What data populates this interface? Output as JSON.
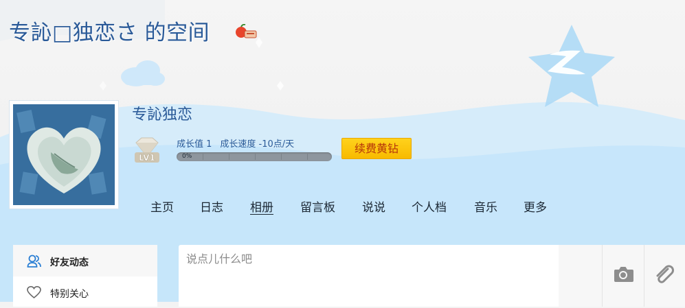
{
  "header": {
    "space_title": "专訫□独恋さ 的空间",
    "title_icon": "apple-vip-icon"
  },
  "profile": {
    "nickname": "专訫独恋",
    "level_badge": "LV1",
    "growth_value": "成长值 1",
    "growth_speed": "成长速度 -10点/天",
    "progress_label": "0%",
    "progress": 0,
    "renew_button": "续费黄钻"
  },
  "nav": {
    "items": [
      "主页",
      "日志",
      "相册",
      "留言板",
      "说说",
      "个人档",
      "音乐",
      "更多"
    ],
    "active": "相册"
  },
  "sidebar": {
    "items": [
      {
        "label": "好友动态",
        "icon": "friends-icon"
      },
      {
        "label": "特别关心",
        "icon": "heart-icon"
      }
    ]
  },
  "composer": {
    "placeholder": "说点儿什么吧",
    "tools": [
      "camera-icon",
      "paperclip-icon"
    ]
  },
  "colors": {
    "accent_blue": "#2a5a98",
    "sky_blue": "#c6e6fa",
    "renew_gold": "#f8ba00",
    "renew_text": "#b5340a"
  }
}
